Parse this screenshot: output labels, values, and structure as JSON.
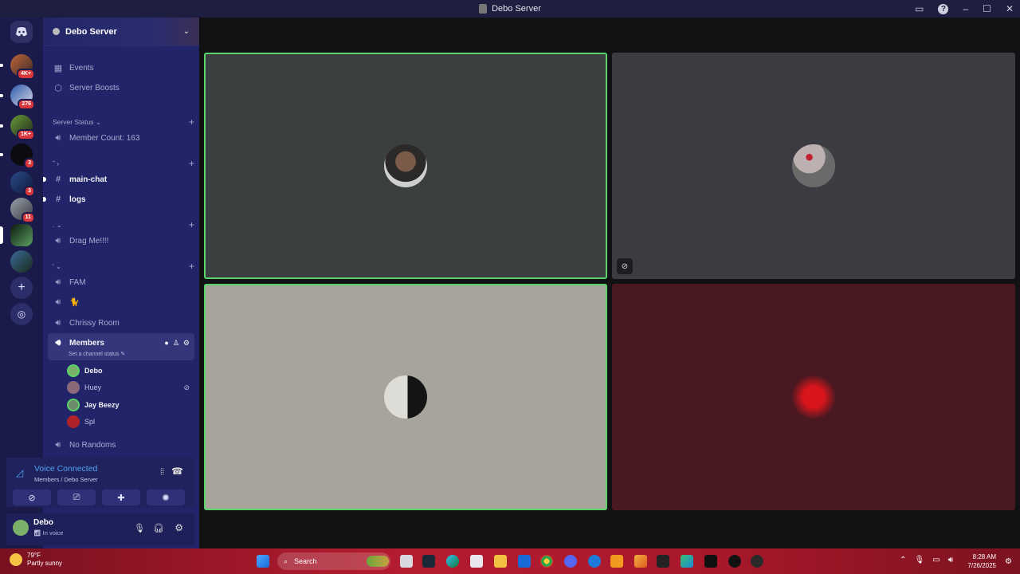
{
  "window": {
    "title": "Debo Server"
  },
  "servers": {
    "badges": [
      "4K+",
      "276",
      "1K+",
      "3",
      "3",
      "11"
    ]
  },
  "server": {
    "name": "Debo Server"
  },
  "sidebar": {
    "events": "Events",
    "boosts": "Server Boosts",
    "cat_status": "Server Status",
    "member_count": "Member Count: 163",
    "cat_text": "",
    "main_chat": "main-chat",
    "logs": "logs",
    "cat_voice1": ".",
    "drag_me": "Drag Me!!!!",
    "cat_voice2": "'",
    "fam": "FAM",
    "dog": "🐈",
    "chrissy": "Chrissy Room",
    "members": "Members",
    "members_status": "Set a channel status",
    "no_randoms": "No Randoms"
  },
  "voice_members": [
    {
      "name": "Debo",
      "color": "#7ab06a"
    },
    {
      "name": "Huey",
      "color": "#8a6a78"
    },
    {
      "name": "Jay Beezy",
      "color": "#6e8a6c"
    },
    {
      "name": "Spl",
      "color": "#b0222a"
    }
  ],
  "voice": {
    "status": "Voice Connected",
    "channel": "Members / Debo Server"
  },
  "user": {
    "name": "Debo",
    "status": "In voice"
  },
  "stage": {
    "tiles": [
      {
        "bg": "#3c3f3f",
        "speaking": true,
        "avatar": "#2c2a28",
        "muted": false
      },
      {
        "bg": "#3b3c42",
        "speaking": false,
        "avatar": "#9c8c8c",
        "muted": true
      },
      {
        "bg": "#a7a49c",
        "speaking": true,
        "avatar": "#dedcd6",
        "muted": false
      },
      {
        "bg": "#4a1820",
        "speaking": false,
        "avatar": "#b3171e",
        "muted": false
      }
    ]
  },
  "taskbar": {
    "temp": "79°F",
    "weather": "Partly sunny",
    "search": "Search",
    "time": "8:28 AM",
    "date": "7/26/2025"
  }
}
